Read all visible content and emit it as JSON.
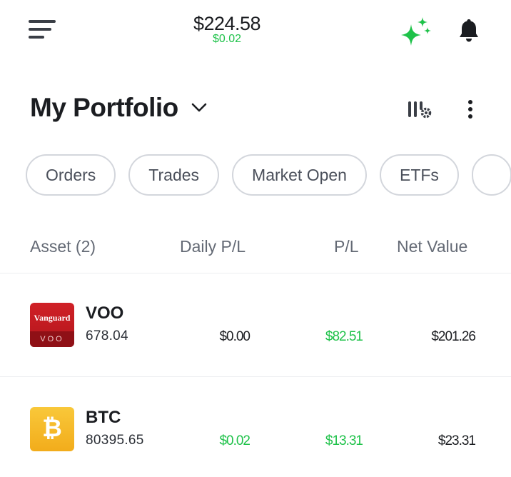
{
  "topbar": {
    "balance": "$224.58",
    "balance_change": "$0.02",
    "menu_icon": "hamburger-menu-icon",
    "sparkle_icon": "sparkle-icon",
    "bell_icon": "notification-bell-icon"
  },
  "header": {
    "title": "My Portfolio",
    "dropdown_icon": "chevron-down-icon",
    "columns_icon": "column-settings-icon",
    "more_icon": "more-vertical-icon"
  },
  "chips": [
    "Orders",
    "Trades",
    "Market Open",
    "ETFs"
  ],
  "table": {
    "headers": {
      "asset": "Asset (2)",
      "daily_pl": "Daily P/L",
      "pl": "P/L",
      "net_value": "Net Value"
    },
    "rows": [
      {
        "symbol": "VOO",
        "price": "678.04",
        "logo_text": "Vanguard",
        "logo_sub": "VOO",
        "daily_pl": "$0.00",
        "pl": "$82.51",
        "net_value": "$201.26"
      },
      {
        "symbol": "BTC",
        "price": "80395.65",
        "logo_text": "₿",
        "daily_pl": "$0.02",
        "pl": "$13.31",
        "net_value": "$23.31"
      }
    ]
  },
  "colors": {
    "gain": "#1fc24a",
    "vanguard_red": "#c4161c",
    "btc_yellow": "#f7b928"
  }
}
